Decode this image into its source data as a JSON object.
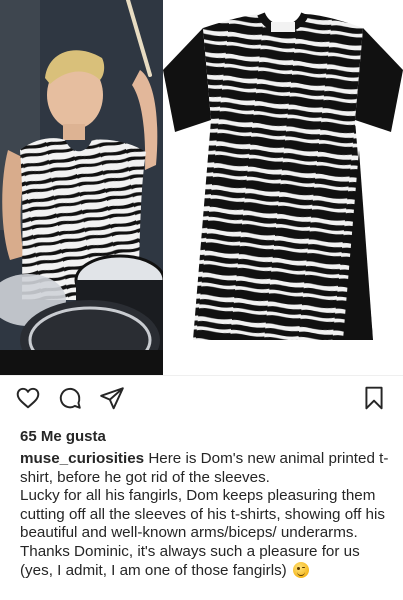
{
  "post": {
    "likes_text": "65 Me gusta",
    "username": "muse_curiosities",
    "caption_first": "Here is Dom's new animal printed t-shirt, before he got rid of the sleeves.",
    "caption_lines": [
      "Lucky for all his fangirls, Dom keeps pleasuring them cutting off all the sleeves of his t-shirts, showing off his beautiful and well-known arms/biceps/ underarms.",
      "Thanks Dominic, it's always such a pleasure for us (yes, I admit, I am one of those fangirls)"
    ],
    "emoji_name": "winking-face-emoji"
  },
  "actions": {
    "like_icon": "heart-icon",
    "comment_icon": "comment-icon",
    "share_icon": "share-icon",
    "save_icon": "bookmark-icon"
  },
  "images": {
    "left_desc_icon": "drummer-photo",
    "right_desc_icon": "tshirt-product-photo"
  },
  "colors": {
    "text": "#262626",
    "icon": "#262626",
    "shirt_black": "#111111",
    "shirt_white": "#f2f2f2"
  }
}
